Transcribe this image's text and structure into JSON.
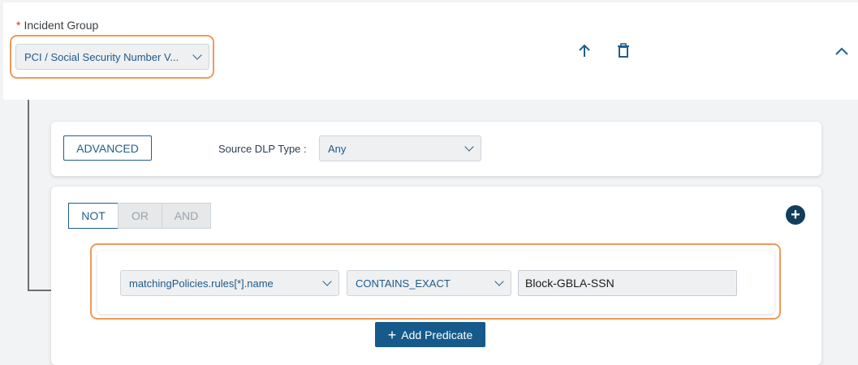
{
  "incident_group": {
    "label": "Incident Group",
    "required_mark": "*",
    "selected": "PCI / Social Security Number V..."
  },
  "header_actions": {
    "move_up_icon": "arrow-up-icon",
    "delete_icon": "trash-icon",
    "collapse_icon": "chevron-up-icon"
  },
  "filter_card": {
    "advanced_label": "ADVANCED",
    "source_dlp_label": "Source DLP Type :",
    "source_dlp_value": "Any"
  },
  "operators": [
    "NOT",
    "OR",
    "AND"
  ],
  "operator_active": "NOT",
  "predicate": {
    "field": "matchingPolicies.rules[*].name",
    "operator": "CONTAINS_EXACT",
    "value": "Block-GBLA-SSN"
  },
  "add_predicate_label": "Add Predicate",
  "add_group_icon": "plus-circle-icon",
  "colors": {
    "accent": "#1f5f8b",
    "highlight": "#ee9a5b",
    "primary_button": "#155a8a"
  }
}
